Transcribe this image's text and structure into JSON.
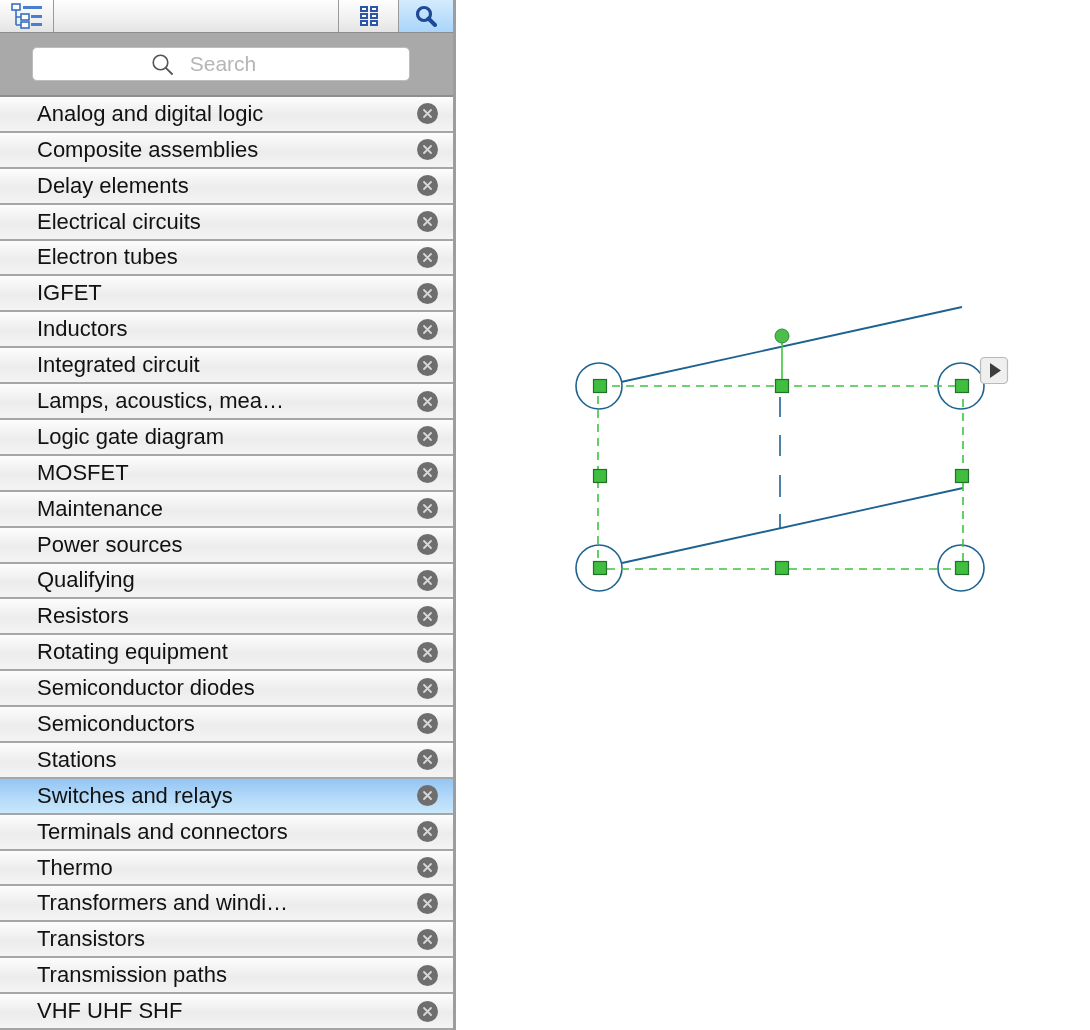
{
  "toolbar": {
    "buttons": [
      {
        "kind": "outline",
        "selected": false
      },
      {
        "kind": "grid",
        "selected": false
      },
      {
        "kind": "search",
        "selected": true
      }
    ]
  },
  "search": {
    "placeholder": "Search"
  },
  "libraries": {
    "items": [
      {
        "label": "Analog and digital logic",
        "selected": false
      },
      {
        "label": "Composite assemblies",
        "selected": false
      },
      {
        "label": "Delay elements",
        "selected": false
      },
      {
        "label": "Electrical circuits",
        "selected": false
      },
      {
        "label": "Electron tubes",
        "selected": false
      },
      {
        "label": "IGFET",
        "selected": false
      },
      {
        "label": "Inductors",
        "selected": false
      },
      {
        "label": "Integrated circuit",
        "selected": false
      },
      {
        "label": "Lamps, acoustics, mea…",
        "selected": false
      },
      {
        "label": "Logic gate diagram",
        "selected": false
      },
      {
        "label": "MOSFET",
        "selected": false
      },
      {
        "label": "Maintenance",
        "selected": false
      },
      {
        "label": "Power sources",
        "selected": false
      },
      {
        "label": "Qualifying",
        "selected": false
      },
      {
        "label": "Resistors",
        "selected": false
      },
      {
        "label": "Rotating equipment",
        "selected": false
      },
      {
        "label": "Semiconductor diodes",
        "selected": false
      },
      {
        "label": "Semiconductors",
        "selected": false
      },
      {
        "label": "Stations",
        "selected": false
      },
      {
        "label": "Switches and relays",
        "selected": true
      },
      {
        "label": "Terminals and connectors",
        "selected": false
      },
      {
        "label": "Thermo",
        "selected": false
      },
      {
        "label": "Transformers and windi…",
        "selected": false
      },
      {
        "label": "Transistors",
        "selected": false
      },
      {
        "label": "Transmission paths",
        "selected": false
      },
      {
        "label": "VHF UHF SHF",
        "selected": false
      }
    ]
  },
  "canvas": {
    "shape": {
      "selected": true
    }
  }
}
